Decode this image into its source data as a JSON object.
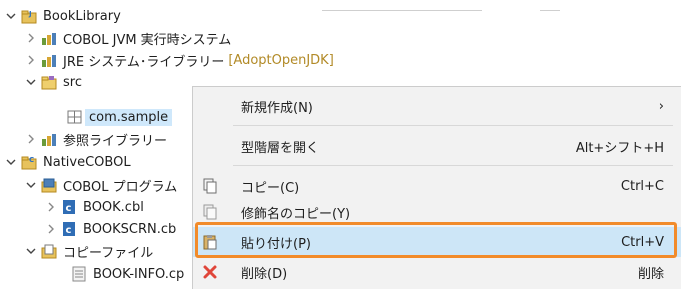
{
  "tree": {
    "items": [
      {
        "label": "BookLibrary"
      },
      {
        "label": "COBOL JVM 実行時システム"
      },
      {
        "label": "JRE システム･ライブラリー",
        "extra": "[AdoptOpenJDK]"
      },
      {
        "label": "src"
      },
      {
        "label": "com.sample"
      },
      {
        "label": "参照ライブラリー"
      },
      {
        "label": "NativeCOBOL"
      },
      {
        "label": "COBOL プログラム"
      },
      {
        "label": "BOOK.cbl"
      },
      {
        "label": "BOOKSCRN.cb"
      },
      {
        "label": "コピーファイル"
      },
      {
        "label": "BOOK-INFO.cp"
      }
    ]
  },
  "context_menu": {
    "items": [
      {
        "label": "新規作成(N)",
        "accel": "›"
      },
      {
        "label": "型階層を開く",
        "accel": "Alt+シフト+H"
      },
      {
        "label": "コピー(C)",
        "accel": "Ctrl+C"
      },
      {
        "label": "修飾名のコピー(Y)",
        "accel": ""
      },
      {
        "label": "貼り付け(P)",
        "accel": "Ctrl+V"
      },
      {
        "label": "削除(D)",
        "accel": "削除"
      }
    ]
  },
  "colors": {
    "selection": "#cfe8fb",
    "menu_highlight": "#cde6f7",
    "focus_outline": "#f28b2a",
    "delete_icon": "#e0463a"
  }
}
